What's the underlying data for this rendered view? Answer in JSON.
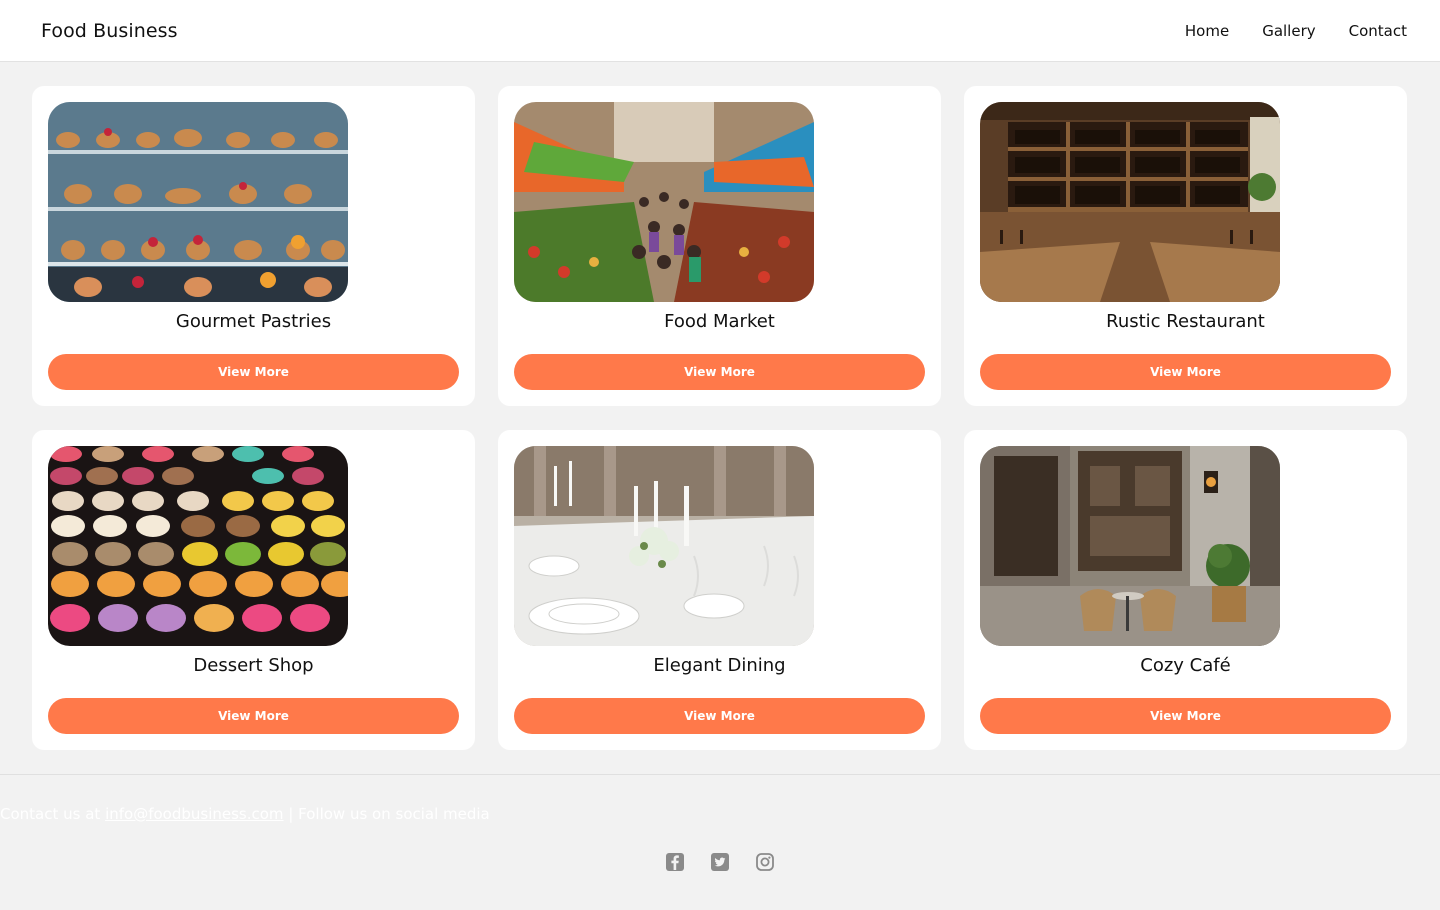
{
  "header": {
    "brand": "Food Business",
    "nav": [
      "Home",
      "Gallery",
      "Contact"
    ]
  },
  "cards": [
    {
      "title": "Gourmet Pastries",
      "button": "View More",
      "image": "pastry-display-case"
    },
    {
      "title": "Food Market",
      "button": "View More",
      "image": "street-food-market"
    },
    {
      "title": "Rustic Restaurant",
      "button": "View More",
      "image": "rustic-wine-restaurant"
    },
    {
      "title": "Dessert Shop",
      "button": "View More",
      "image": "macaron-shelves"
    },
    {
      "title": "Elegant Dining",
      "button": "View More",
      "image": "formal-table-setting"
    },
    {
      "title": "Cozy Café",
      "button": "View More",
      "image": "cafe-storefront"
    }
  ],
  "footer": {
    "prefix": "Contact us at ",
    "email": "info@foodbusiness.com",
    "suffix": " | Follow us on social media",
    "socials": [
      "facebook-icon",
      "twitter-icon",
      "instagram-icon"
    ]
  },
  "colors": {
    "accent": "#ff794a",
    "background": "#f2f2f2",
    "card": "#ffffff",
    "social_icon": "#8a8a8a"
  }
}
